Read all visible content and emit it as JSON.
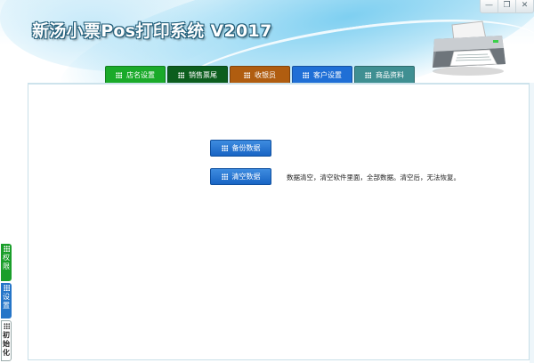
{
  "app": {
    "title": "新汤小票Pos打印系统 V2017"
  },
  "window_controls": {
    "minimize": "—",
    "restore": "❐",
    "close": "✕"
  },
  "nav": {
    "tabs": [
      {
        "label": "店名设置",
        "color": "#1aaa2a"
      },
      {
        "label": "销售票尾",
        "color": "#0c5e1e"
      },
      {
        "label": "收银员",
        "color": "#b05d10"
      },
      {
        "label": "客户设置",
        "color": "#1f6fd6"
      },
      {
        "label": "商品资料",
        "color": "#3f8f92"
      }
    ]
  },
  "content": {
    "backup_button": "备份数据",
    "clear_button": "清空数据",
    "clear_note": "数据清空，清空软件里面，全部数据。清空后，无法恢复。"
  },
  "sidebar": {
    "tabs": [
      {
        "label": "权\n限",
        "color": "#1a9e2a"
      },
      {
        "label": "设\n置",
        "color": "#2575c8"
      },
      {
        "label": "初\n始\n化",
        "color": "#ffffff"
      }
    ]
  }
}
